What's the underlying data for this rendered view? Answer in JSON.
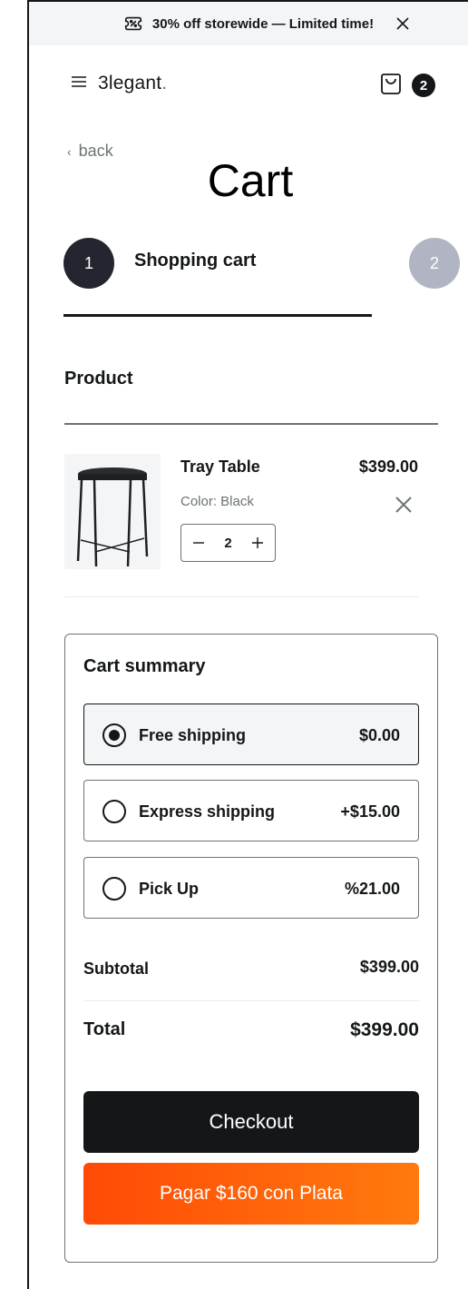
{
  "promo": {
    "text": "30% off storewide — Limited time!"
  },
  "nav": {
    "logo_text": "3legant",
    "logo_dot": ".",
    "cart_count": "2"
  },
  "page": {
    "back_label": "back",
    "title": "Cart"
  },
  "steps": [
    {
      "number": "1",
      "label": "Shopping cart"
    },
    {
      "number": "2"
    }
  ],
  "table": {
    "product_header": "Product"
  },
  "cart_items": [
    {
      "name": "Tray Table",
      "color_label": "Color: Black",
      "quantity": "2",
      "price": "$399.00"
    }
  ],
  "summary": {
    "title": "Cart summary",
    "shipping_options": [
      {
        "label": "Free shipping",
        "amount": "$0.00",
        "selected": true
      },
      {
        "label": "Express shipping",
        "amount": "+$15.00",
        "selected": false
      },
      {
        "label": "Pick Up",
        "amount": "%21.00",
        "selected": false
      }
    ],
    "subtotal_label": "Subtotal",
    "subtotal_value": "$399.00",
    "total_label": "Total",
    "total_value": "$399.00",
    "checkout_label": "Checkout",
    "plata_label": "Pagar $160 con Plata"
  },
  "colors": {
    "primary": "#141718",
    "muted": "#6c7275",
    "step_inactive": "#b1b5c3",
    "plata_start": "#ff4a06",
    "plata_end": "#ff7a0e"
  },
  "icons": [
    "ticket-percent-icon",
    "close-icon",
    "menu-icon",
    "shopping-bag-icon",
    "chevron-left-icon",
    "minus-icon",
    "plus-icon",
    "radio-icon"
  ]
}
